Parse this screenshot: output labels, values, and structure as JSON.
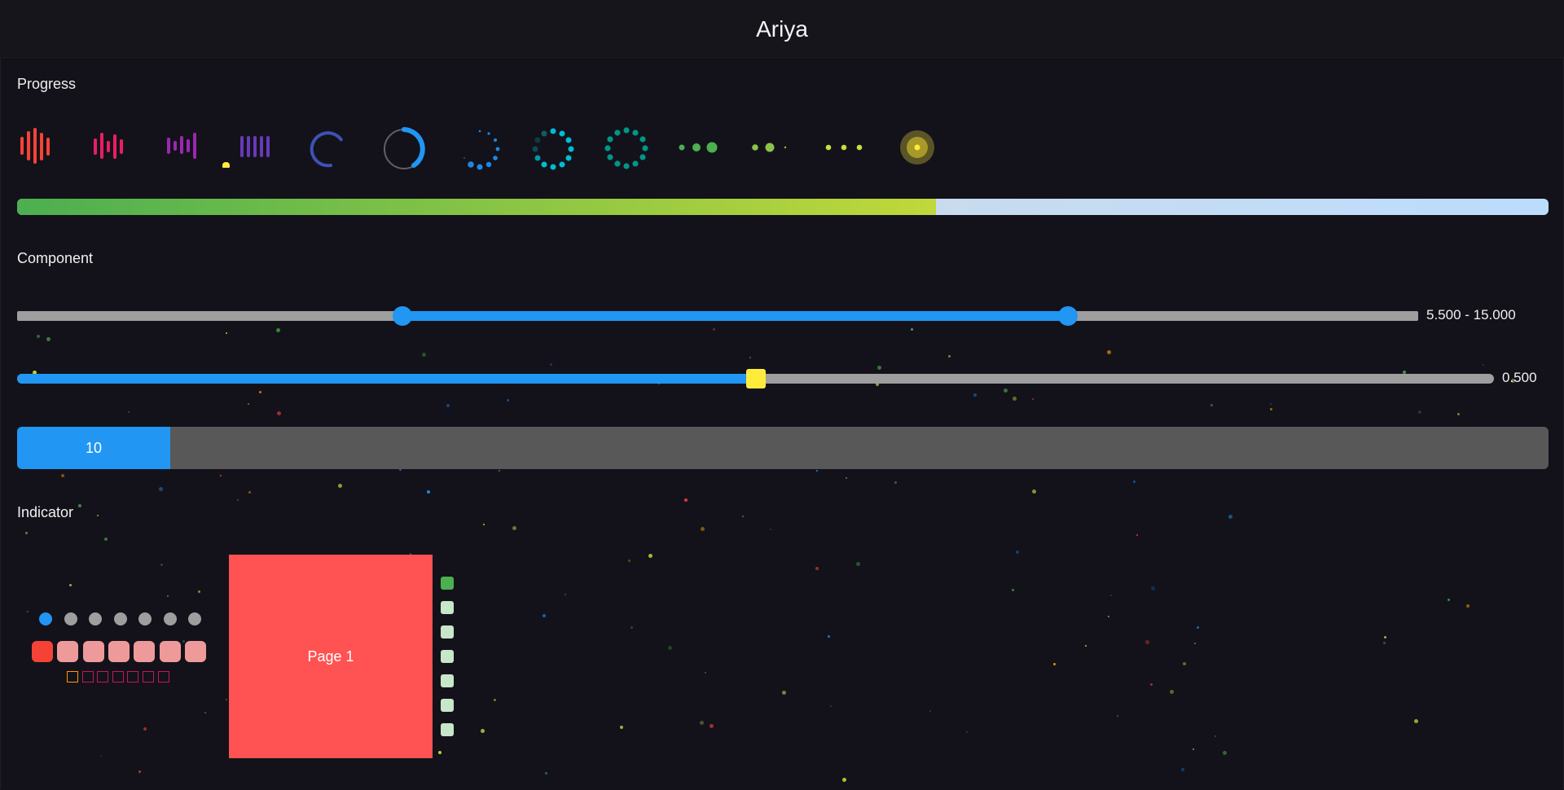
{
  "app": {
    "title": "Ariya"
  },
  "sections": {
    "progress": "Progress",
    "component": "Component",
    "indicator": "Indicator"
  },
  "progress_bar": {
    "value_fraction": 0.6
  },
  "range_slider": {
    "min": 0,
    "max": 20,
    "low": 5.5,
    "high": 15.0,
    "value_text": "5.500 - 15.000",
    "color": "#2196f3"
  },
  "single_slider": {
    "value": 0.5,
    "value_text": "0.500",
    "thumb_color": "#ffeb3b"
  },
  "value_bar": {
    "fraction": 0.1,
    "text": "10"
  },
  "indicator": {
    "dots_count": 7,
    "active_index": 0,
    "page_label": "Page 1",
    "active_color": "#2196f3",
    "pill_active_color": "#f44336",
    "page_color": "#ff5252"
  },
  "spinners": [
    "bars-red-icon",
    "bars-pink-icon",
    "bars-purple-icon",
    "bars-violet-icon",
    "arc-indigo-icon",
    "ring-blue-icon",
    "dots-circle-blue-icon",
    "dots-circle-cyan-icon",
    "dots-circle-teal-icon",
    "dots-pulse-green-icon",
    "dots-wave-lightgreen-icon",
    "dots-lime-icon",
    "ripple-yellow-icon"
  ]
}
